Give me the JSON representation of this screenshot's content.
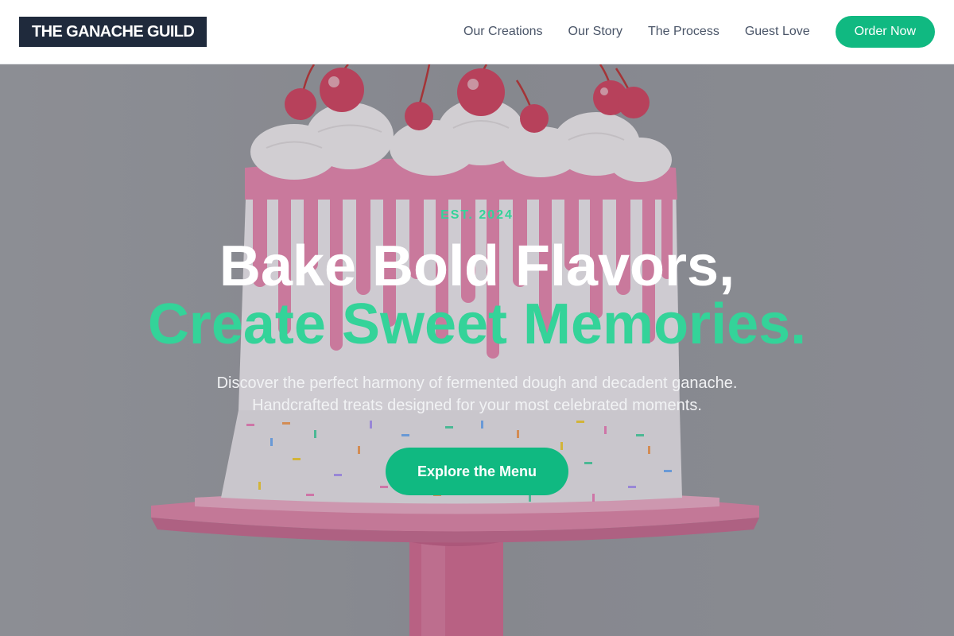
{
  "header": {
    "logo_text": "THE GANACHE GUILD",
    "nav": [
      {
        "label": "Our Creations"
      },
      {
        "label": "Our Story"
      },
      {
        "label": "The Process"
      },
      {
        "label": "Guest Love"
      }
    ],
    "order_label": "Order Now"
  },
  "hero": {
    "eyebrow": "EST. 2024",
    "headline_line1": "Bake Bold Flavors,",
    "headline_line2": "Create Sweet Memories.",
    "subtext_line1": "Discover the perfect harmony of fermented dough and decadent ganache.",
    "subtext_line2": "Handcrafted treats designed for your most celebrated moments.",
    "cta_label": "Explore the Menu",
    "background_image": "pink drip cake with whipped cream, cherries and rainbow sprinkles on a pink cake stand"
  },
  "colors": {
    "accent": "#10b981",
    "accent_light": "#34d399",
    "logo_bg": "#1f2a3c",
    "nav_text": "#4a5568"
  }
}
